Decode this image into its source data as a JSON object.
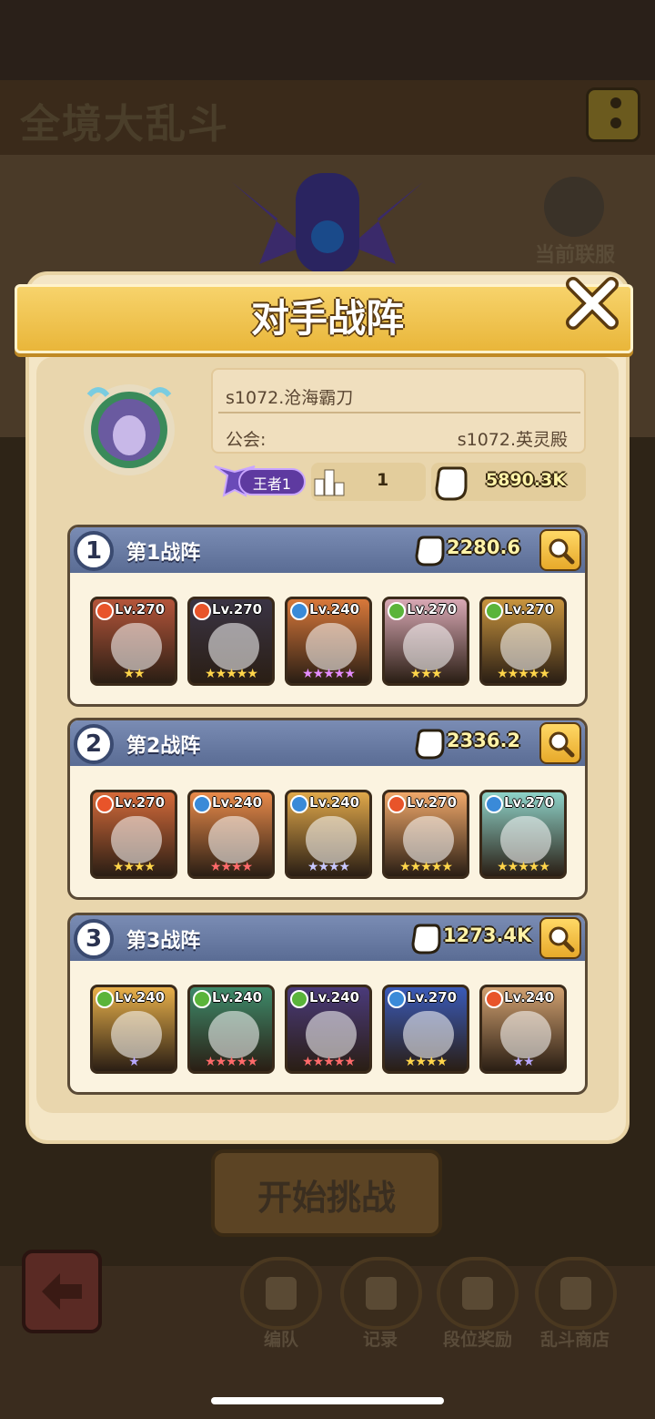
{
  "header": {
    "title": "全境大乱斗",
    "server_label": "当前联服"
  },
  "dialog": {
    "title": "对手战阵"
  },
  "opponent": {
    "name": "s1072.沧海霸刀",
    "guild_label": "公会:",
    "guild_name": "s1072.英灵殿",
    "rank": "王者1",
    "position": "1",
    "total_power": "5890.3K"
  },
  "teams": [
    {
      "num": "1",
      "name": "第1战阵",
      "power": "2280.6",
      "heroes": [
        {
          "lv": "Lv.270",
          "element": "fire",
          "stars": "★★",
          "star_color": "#ffd54a",
          "bg": "#b4553a"
        },
        {
          "lv": "Lv.270",
          "element": "fire",
          "stars": "★★★★★",
          "star_color": "#ffd54a",
          "bg": "#3a3444"
        },
        {
          "lv": "Lv.240",
          "element": "water",
          "stars": "★★★★★",
          "star_color": "#e48cff",
          "bg": "#d8783a"
        },
        {
          "lv": "Lv.270",
          "element": "nature",
          "stars": "★★★",
          "star_color": "#ffd54a",
          "bg": "#d8a8b4"
        },
        {
          "lv": "Lv.270",
          "element": "nature",
          "stars": "★★★★★",
          "star_color": "#ffd54a",
          "bg": "#c8943e"
        }
      ]
    },
    {
      "num": "2",
      "name": "第2战阵",
      "power": "2336.2",
      "heroes": [
        {
          "lv": "Lv.270",
          "element": "fire",
          "stars": "★★★★",
          "star_color": "#ffd54a",
          "bg": "#d46a3a"
        },
        {
          "lv": "Lv.240",
          "element": "water",
          "stars": "★★★★",
          "star_color": "#ff6a6a",
          "bg": "#e88a4a"
        },
        {
          "lv": "Lv.240",
          "element": "water",
          "stars": "★★★★",
          "star_color": "#c8c8ff",
          "bg": "#e0a84a"
        },
        {
          "lv": "Lv.270",
          "element": "fire",
          "stars": "★★★★★",
          "star_color": "#ffd54a",
          "bg": "#f0a86a"
        },
        {
          "lv": "Lv.270",
          "element": "water",
          "stars": "★★★★★",
          "star_color": "#ffd54a",
          "bg": "#8ed2c8"
        }
      ]
    },
    {
      "num": "3",
      "name": "第3战阵",
      "power": "1273.4K",
      "heroes": [
        {
          "lv": "Lv.240",
          "element": "nature",
          "stars": "★",
          "star_color": "#b8a8ff",
          "bg": "#e8b04a"
        },
        {
          "lv": "Lv.240",
          "element": "nature",
          "stars": "★★★★★",
          "star_color": "#ff6a6a",
          "bg": "#3e8a6a"
        },
        {
          "lv": "Lv.240",
          "element": "nature",
          "stars": "★★★★★",
          "star_color": "#ff6a6a",
          "bg": "#4a3a7a"
        },
        {
          "lv": "Lv.270",
          "element": "water",
          "stars": "★★★★",
          "star_color": "#ffd54a",
          "bg": "#3a5ab8"
        },
        {
          "lv": "Lv.240",
          "element": "fire",
          "stars": "★★",
          "star_color": "#b8a8ff",
          "bg": "#d0a070"
        }
      ]
    }
  ],
  "buttons": {
    "start": "开始挑战"
  },
  "nav": [
    {
      "label": "编队",
      "icon": "formation-icon"
    },
    {
      "label": "记录",
      "icon": "record-icon"
    },
    {
      "label": "段位奖励",
      "icon": "rank-reward-icon"
    },
    {
      "label": "乱斗商店",
      "icon": "shop-icon"
    }
  ],
  "colors": {
    "fire": "#e8542a",
    "water": "#3a8ad8",
    "nature": "#5ab43a"
  }
}
